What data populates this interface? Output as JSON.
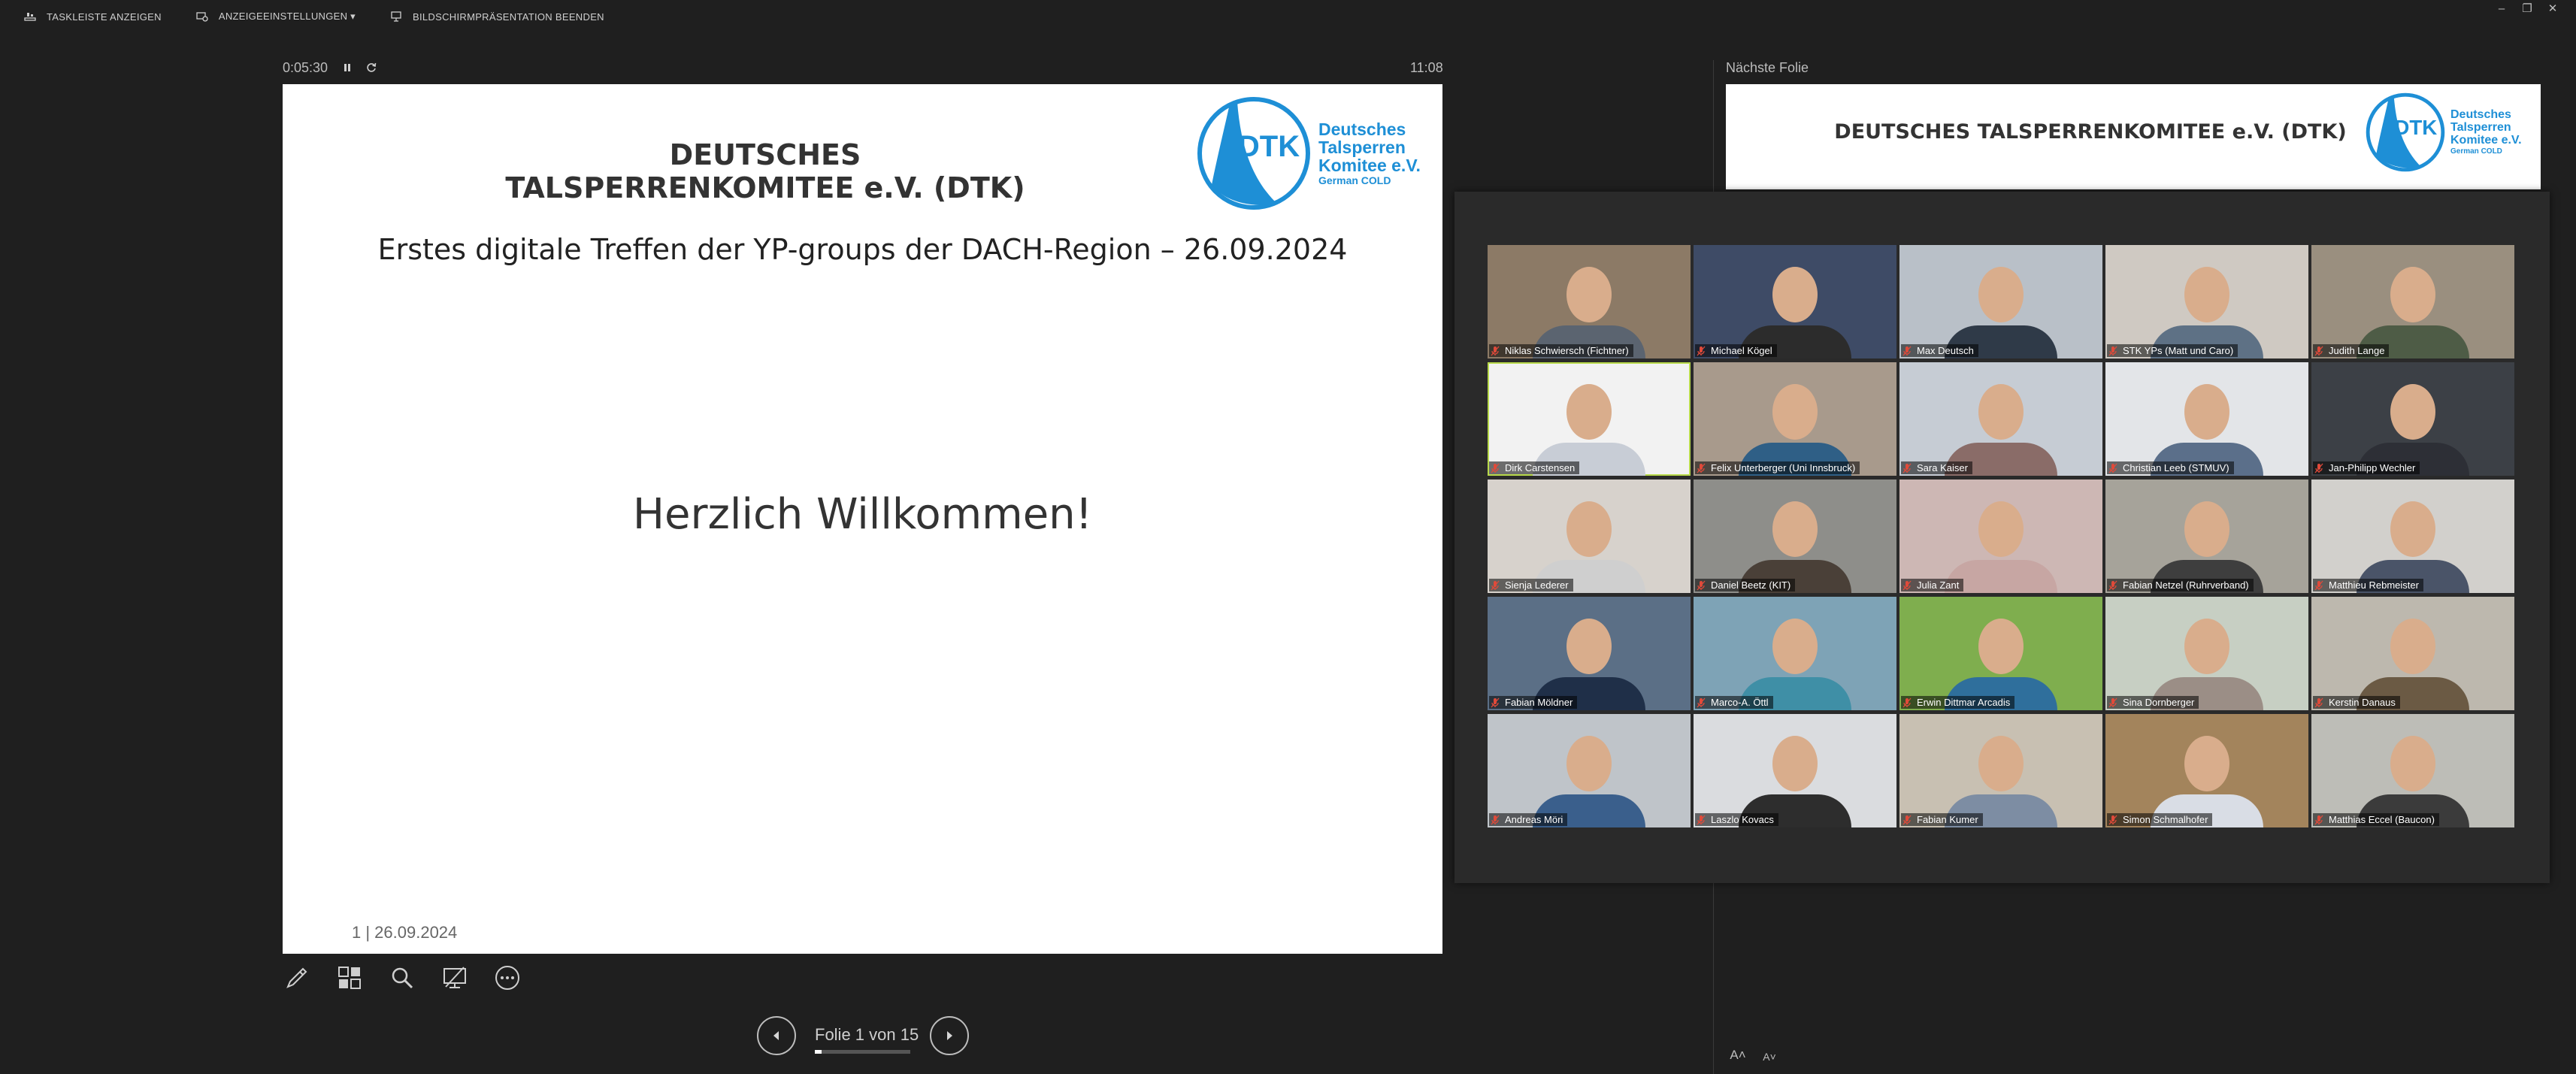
{
  "topbar": {
    "show_taskbar": "TASKLEISTE ANZEIGEN",
    "display_settings": "ANZEIGEEINSTELLUNGEN ▾",
    "end_show": "BILDSCHIRMPRÄSENTATION BEENDEN"
  },
  "window": {
    "minimize": "–",
    "restore": "❐",
    "close": "✕"
  },
  "timer": {
    "elapsed": "0:05:30",
    "clock": "11:08"
  },
  "slide": {
    "header": "DEUTSCHES TALSPERRENKOMITEE e.V. (DTK)",
    "subtitle": "Erstes digitale Treffen der YP-groups der DACH-Region  – 26.09.2024",
    "body": "Herzlich Willkommen!",
    "footer": "1  |  26.09.2024",
    "logo": {
      "abbr": "DTK",
      "line1": "Deutsches",
      "line2": "Talsperren",
      "line3": "Komitee e.V.",
      "line4": "German COLD"
    }
  },
  "navigation": {
    "counter": "Folie 1 von 15",
    "progress_fraction": 0.067
  },
  "next_slide": {
    "label": "Nächste Folie",
    "header": "DEUTSCHES TALSPERRENKOMITEE e.V. (DTK)"
  },
  "participants": [
    {
      "name": "Niklas Schwiersch (Fichtner)"
    },
    {
      "name": "Michael Kögel"
    },
    {
      "name": "Max Deutsch"
    },
    {
      "name": "STK YPs (Matt und Caro)"
    },
    {
      "name": "Judith Lange"
    },
    {
      "name": "Dirk Carstensen"
    },
    {
      "name": "Felix Unterberger (Uni Innsbruck)"
    },
    {
      "name": "Sara Kaiser"
    },
    {
      "name": "Christian Leeb (STMUV)"
    },
    {
      "name": "Jan-Philipp Wechler"
    },
    {
      "name": "Sienja Lederer"
    },
    {
      "name": "Daniel Beetz (KIT)"
    },
    {
      "name": "Julia Zant"
    },
    {
      "name": "Fabian Netzel (Ruhrverband)"
    },
    {
      "name": "Matthieu Rebmeister"
    },
    {
      "name": "Fabian Möldner"
    },
    {
      "name": "Marco-A. Öttl"
    },
    {
      "name": "Erwin Dittmar Arcadis"
    },
    {
      "name": "Sina Dornberger"
    },
    {
      "name": "Kerstin Danaus"
    },
    {
      "name": "Andreas Möri"
    },
    {
      "name": "Laszlo Kovacs"
    },
    {
      "name": "Fabian Kumer"
    },
    {
      "name": "Simon Schmalhofer"
    },
    {
      "name": "Matthias Eccel (Baucon)"
    }
  ],
  "colors": {
    "accent_logo": "#1e8fd6",
    "active_speaker": "#b8d94a",
    "background": "#1f1f1f"
  }
}
